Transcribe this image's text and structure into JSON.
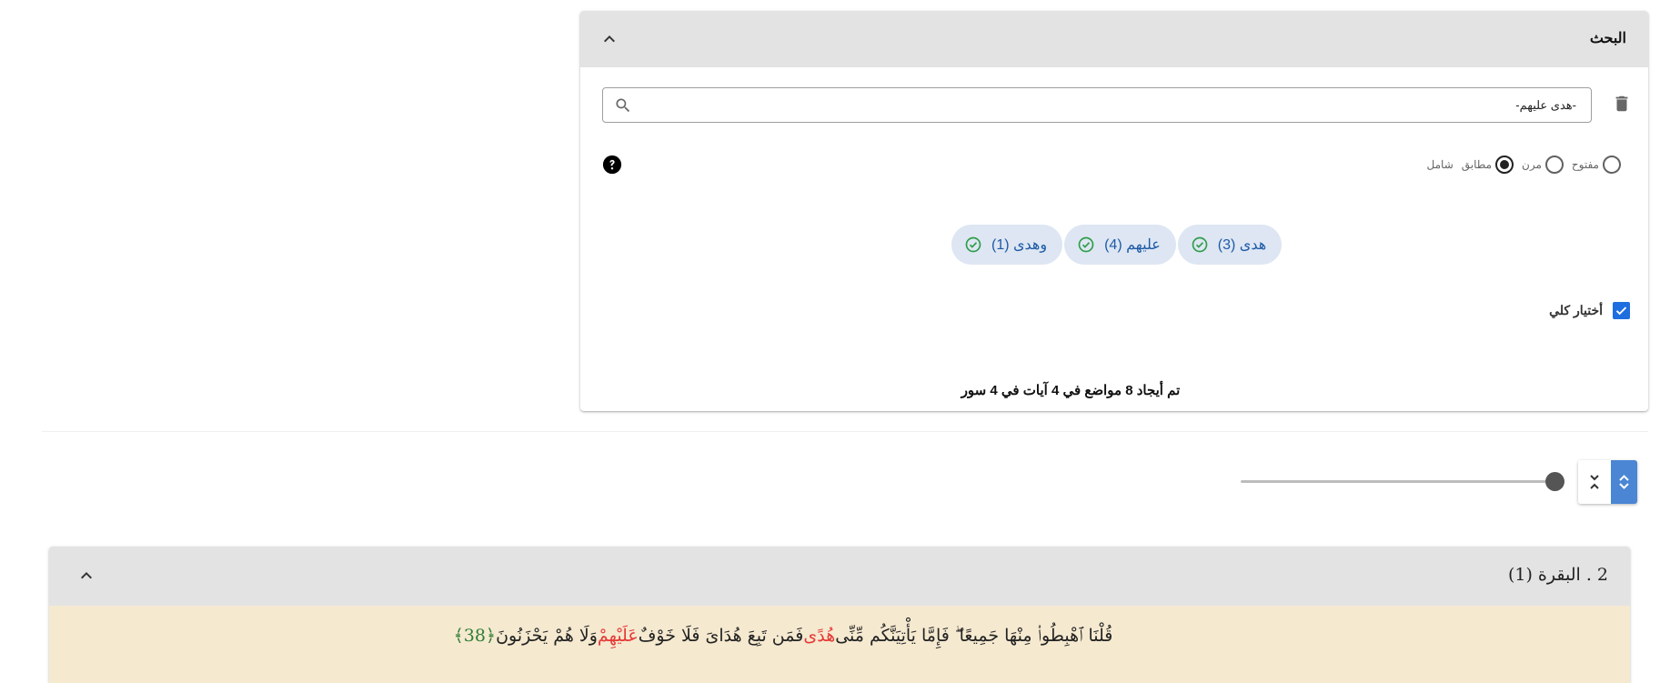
{
  "search_panel": {
    "title": "البحث",
    "query": "-هدى عليهم-",
    "modes": [
      {
        "label": "مفتوح",
        "checked": false
      },
      {
        "label": "مرن",
        "checked": false
      },
      {
        "label": "مطابق",
        "checked": true
      },
      {
        "label": "شامل",
        "checked": false
      }
    ],
    "chips": [
      {
        "label": "هدى (3)",
        "checked": true
      },
      {
        "label": "عليهم (4)",
        "checked": true
      },
      {
        "label": "وهدى (1)",
        "checked": true
      }
    ],
    "select_all_label": "أختيار كلي",
    "select_all_checked": true,
    "result_summary": "تم أيجاد 8 مواضع في 4 آيات في 4 سور"
  },
  "results": {
    "slider_value": 1.0,
    "surah": {
      "title": "2 . البقرة (1)",
      "verse": {
        "part1": "قُلْنَا ٱهْبِطُوا۟ مِنْهَا جَمِيعًا ۖ فَإِمَّا يَأْتِيَنَّكُم مِّنِّى ",
        "hl1": "هُدًى",
        "part2": " فَمَن تَبِعَ هُدَاىَ فَلَا خَوْفٌ ",
        "hl2": "عَلَيْهِمْ",
        "part3": " وَلَا هُمْ يَحْزَنُونَ ",
        "number": "﴿38﴾"
      }
    }
  },
  "colors": {
    "header_bg": "#e3e3e3",
    "chip_bg": "#dde6f2",
    "chip_text": "#1e5aa8",
    "chip_check": "#2e9d4a",
    "checkbox": "#1e6ee0",
    "verse_bg": "#f5e9d0",
    "highlight": "#e53935",
    "ayah_number": "#2e7d32",
    "expand_button": "#4a86d4"
  }
}
